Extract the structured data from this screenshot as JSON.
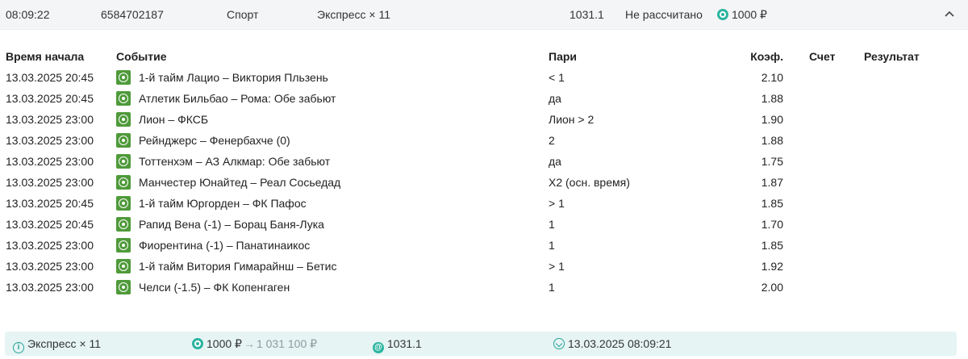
{
  "header": {
    "time": "08:09:22",
    "bet_id": "6584702187",
    "category": "Спорт",
    "bet_type": "Экспресс × 11",
    "total_coef": "1031.1",
    "status": "Не рассчитано",
    "stake": "1000 ₽",
    "collapse_icon": "chevron-up-icon"
  },
  "table": {
    "columns": {
      "start_time": "Время начала",
      "event": "Событие",
      "bet": "Пари",
      "coef": "Коэф.",
      "score": "Счет",
      "result": "Результат"
    },
    "rows": [
      {
        "start_time": "13.03.2025 20:45",
        "event": "1-й тайм Лацио – Виктория Пльзень",
        "bet": "< 1",
        "coef": "2.10"
      },
      {
        "start_time": "13.03.2025 20:45",
        "event": "Атлетик Бильбао – Рома: Обе забьют",
        "bet": "да",
        "coef": "1.88"
      },
      {
        "start_time": "13.03.2025 23:00",
        "event": "Лион – ФКСБ",
        "bet": "Лион > 2",
        "coef": "1.90"
      },
      {
        "start_time": "13.03.2025 23:00",
        "event": "Рейнджерс – Фенербахче (0)",
        "bet": "2",
        "coef": "1.88"
      },
      {
        "start_time": "13.03.2025 23:00",
        "event": "Тоттенхэм – АЗ Алкмар: Обе забьют",
        "bet": "да",
        "coef": "1.75"
      },
      {
        "start_time": "13.03.2025 23:00",
        "event": "Манчестер Юнайтед – Реал Сосьедад",
        "bet": "Х2 (осн. время)",
        "coef": "1.87"
      },
      {
        "start_time": "13.03.2025 20:45",
        "event": "1-й тайм Юргорден – ФК Пафос",
        "bet": "> 1",
        "coef": "1.85"
      },
      {
        "start_time": "13.03.2025 20:45",
        "event": "Рапид Вена (-1) – Борац Баня-Лука",
        "bet": "1",
        "coef": "1.70"
      },
      {
        "start_time": "13.03.2025 23:00",
        "event": "Фиорентина (-1) – Панатинаикос",
        "bet": "1",
        "coef": "1.85"
      },
      {
        "start_time": "13.03.2025 23:00",
        "event": "1-й тайм Витория Гимарайнш – Бетис",
        "bet": "> 1",
        "coef": "1.92"
      },
      {
        "start_time": "13.03.2025 23:00",
        "event": "Челси (-1.5) – ФК Копенгаген",
        "bet": "1",
        "coef": "2.00"
      }
    ]
  },
  "footer": {
    "bet_type": "Экспресс × 11",
    "stake": "1000 ₽",
    "potential_win": "1 031 100 ₽",
    "coef": "1031.1",
    "datetime": "13.03.2025 08:09:21"
  },
  "colors": {
    "accent": "#2bb4a0",
    "sport_icon": "#4f9a3a",
    "footer_bg": "#e6f4f4",
    "header_bg": "#f4f5f7"
  }
}
